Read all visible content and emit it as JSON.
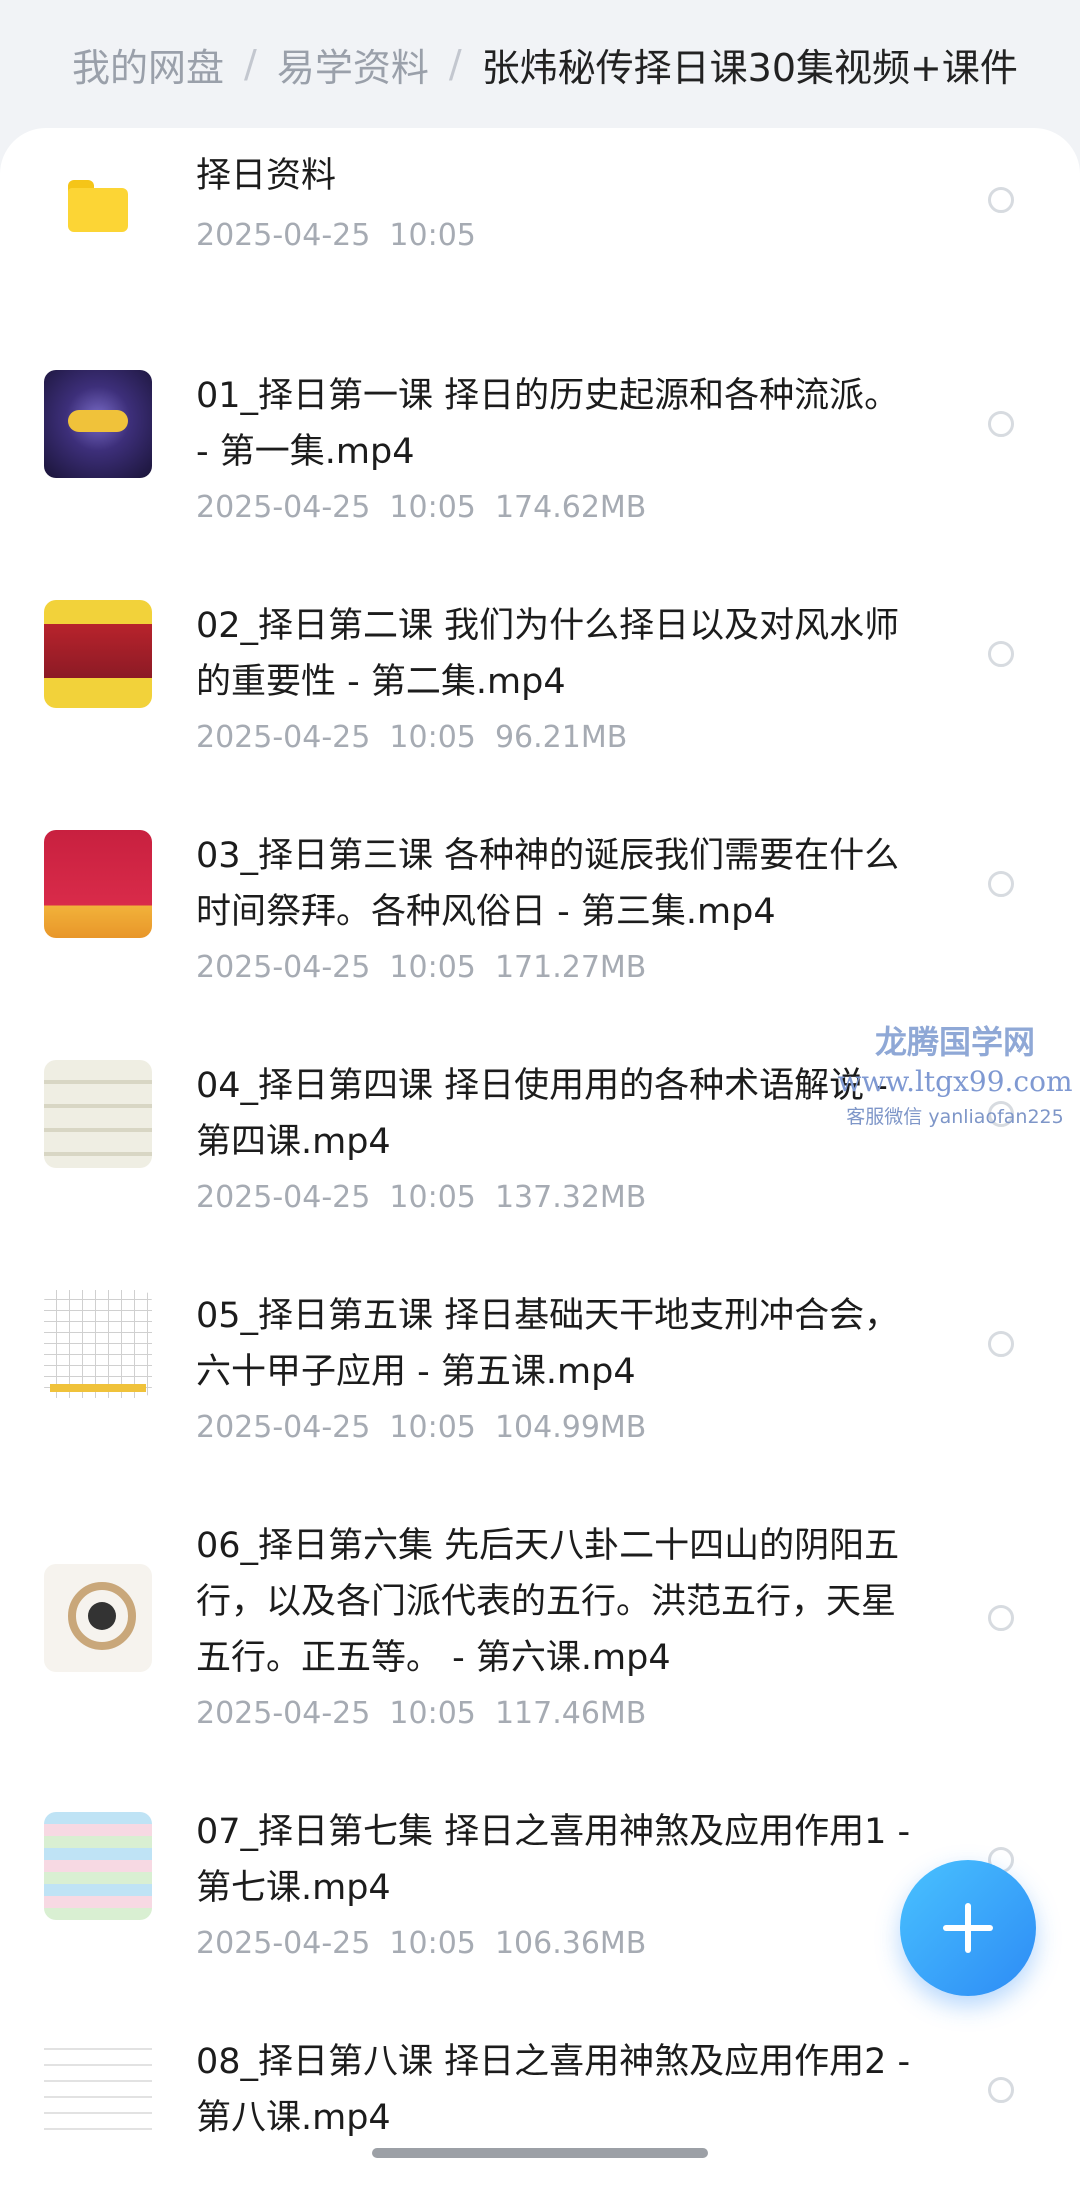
{
  "breadcrumb": {
    "root": "我的网盘",
    "parent": "易学资料",
    "current": "张炜秘传择日课30集视频+课件",
    "separator": "/"
  },
  "files": [
    {
      "name": "择日资料",
      "date": "2025-04-25  10:05",
      "size": "",
      "type": "folder",
      "thumb_icon": "folder-icon"
    },
    {
      "name": "01_择日第一课 择日的历史起源和各种流派。 - 第一集.mp4",
      "date": "2025-04-25  10:05",
      "size": "174.62MB",
      "type": "video",
      "thumb_icon": "video-thumbnail-constellation"
    },
    {
      "name": "02_择日第二课 我们为什么择日以及对风水师的重要性 - 第二集.mp4",
      "date": "2025-04-25  10:05",
      "size": "96.21MB",
      "type": "video",
      "thumb_icon": "video-thumbnail-ceremony"
    },
    {
      "name": "03_择日第三课 各种神的诞辰我们需要在什么时间祭拜。各种风俗日 - 第三集.mp4",
      "date": "2025-04-25  10:05",
      "size": "171.27MB",
      "type": "video",
      "thumb_icon": "video-thumbnail-festival"
    },
    {
      "name": "04_择日第四课 择日使用用的各种术语解说 - 第四课.mp4",
      "date": "2025-04-25  10:05",
      "size": "137.32MB",
      "type": "video",
      "thumb_icon": "video-thumbnail-terms"
    },
    {
      "name": "05_择日第五课 择日基础天干地支刑冲合会，六十甲子应用 - 第五课.mp4",
      "date": "2025-04-25  10:05",
      "size": "104.99MB",
      "type": "video",
      "thumb_icon": "video-thumbnail-table"
    },
    {
      "name": "06_择日第六集 先后天八卦二十四山的阴阳五行，以及各门派代表的五行。洪范五行，天星五行。正五等。 - 第六课.mp4",
      "date": "2025-04-25  10:05",
      "size": "117.46MB",
      "type": "video",
      "thumb_icon": "video-thumbnail-bagua"
    },
    {
      "name": "07_择日第七集 择日之喜用神煞及应用作用1 - 第七课.mp4",
      "date": "2025-04-25  10:05",
      "size": "106.36MB",
      "type": "video",
      "thumb_icon": "video-thumbnail-chart"
    },
    {
      "name": "08_择日第八课 择日之喜用神煞及应用作用2 - 第八课.mp4",
      "date": "",
      "size": "",
      "type": "video",
      "thumb_icon": "video-thumbnail-document"
    }
  ],
  "watermark": {
    "brand": "龙腾国学网",
    "url": "www.ltgx99.com",
    "contact": "客服微信 yanliaofan225"
  },
  "fab": {
    "icon": "plus-icon"
  },
  "colors": {
    "accent": "#2d8bf5",
    "folder": "#fcd535",
    "meta": "#a6abb3"
  }
}
